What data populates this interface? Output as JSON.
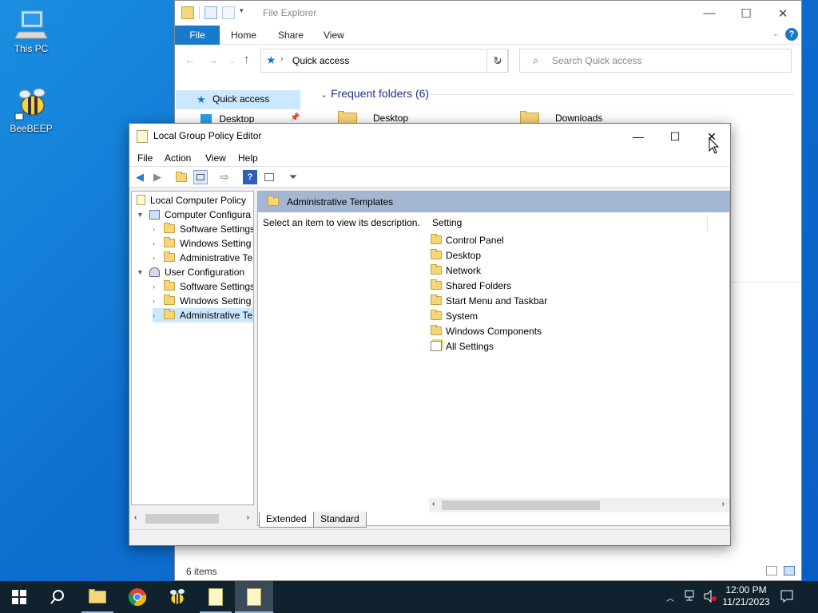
{
  "desktop": {
    "icons": [
      {
        "label": "This PC",
        "icon": "computer-icon"
      },
      {
        "label": "BeeBEEP",
        "icon": "bee-icon"
      }
    ]
  },
  "explorer": {
    "title": "File Explorer",
    "ribbon_tabs": [
      "File",
      "Home",
      "Share",
      "View"
    ],
    "address": "Quick access",
    "search_placeholder": "Search Quick access",
    "nav": {
      "quick_access": "Quick access",
      "desktop": "Desktop"
    },
    "frequent_folders_heading": "Frequent folders (6)",
    "folders": [
      "Desktop",
      "Downloads"
    ],
    "status": "6 items"
  },
  "gpe": {
    "title": "Local Group Policy Editor",
    "menu": [
      "File",
      "Action",
      "View",
      "Help"
    ],
    "tree": [
      {
        "label": "Local Computer Policy",
        "level": 0
      },
      {
        "label": "Computer Configura",
        "level": 1
      },
      {
        "label": "Software Settings",
        "level": 2
      },
      {
        "label": "Windows Setting",
        "level": 2
      },
      {
        "label": "Administrative Te",
        "level": 2
      },
      {
        "label": "User Configuration",
        "level": 1
      },
      {
        "label": "Software Settings",
        "level": 2
      },
      {
        "label": "Windows Setting",
        "level": 2
      },
      {
        "label": "Administrative Te",
        "level": 2
      }
    ],
    "detail_header": "Administrative Templates",
    "description": "Select an item to view its description.",
    "column_setting": "Setting",
    "items": [
      "Control Panel",
      "Desktop",
      "Network",
      "Shared Folders",
      "Start Menu and Taskbar",
      "System",
      "Windows Components",
      "All Settings"
    ],
    "tabs": [
      "Extended",
      "Standard"
    ]
  },
  "taskbar": {
    "time": "12:00 PM",
    "date": "11/21/2023"
  },
  "colors": {
    "accent": "#1979ca",
    "selection": "#cce8ff",
    "header": "#a4b7d2",
    "taskbar": "#10222e"
  }
}
